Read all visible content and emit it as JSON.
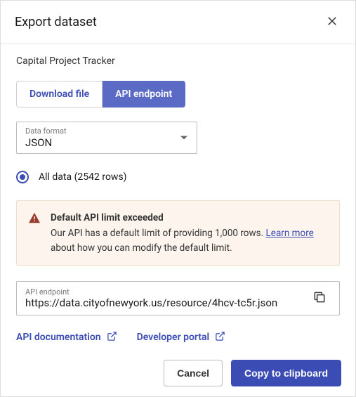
{
  "dialog": {
    "title": "Export dataset",
    "dataset_name": "Capital Project Tracker"
  },
  "tabs": {
    "download": "Download file",
    "api": "API endpoint"
  },
  "format": {
    "label": "Data format",
    "value": "JSON"
  },
  "scope": {
    "all_label": "All data (2542 rows)"
  },
  "warning": {
    "title": "Default API limit exceeded",
    "text_before": "Our API has a default limit of providing 1,000 rows. ",
    "link": "Learn more",
    "text_after": " about how you can modify the default limit."
  },
  "endpoint": {
    "label": "API endpoint",
    "value": "https://data.cityofnewyork.us/resource/4hcv-tc5r.json"
  },
  "links": {
    "api_docs": "API documentation",
    "dev_portal": "Developer portal"
  },
  "footer": {
    "cancel": "Cancel",
    "copy": "Copy to clipboard"
  }
}
